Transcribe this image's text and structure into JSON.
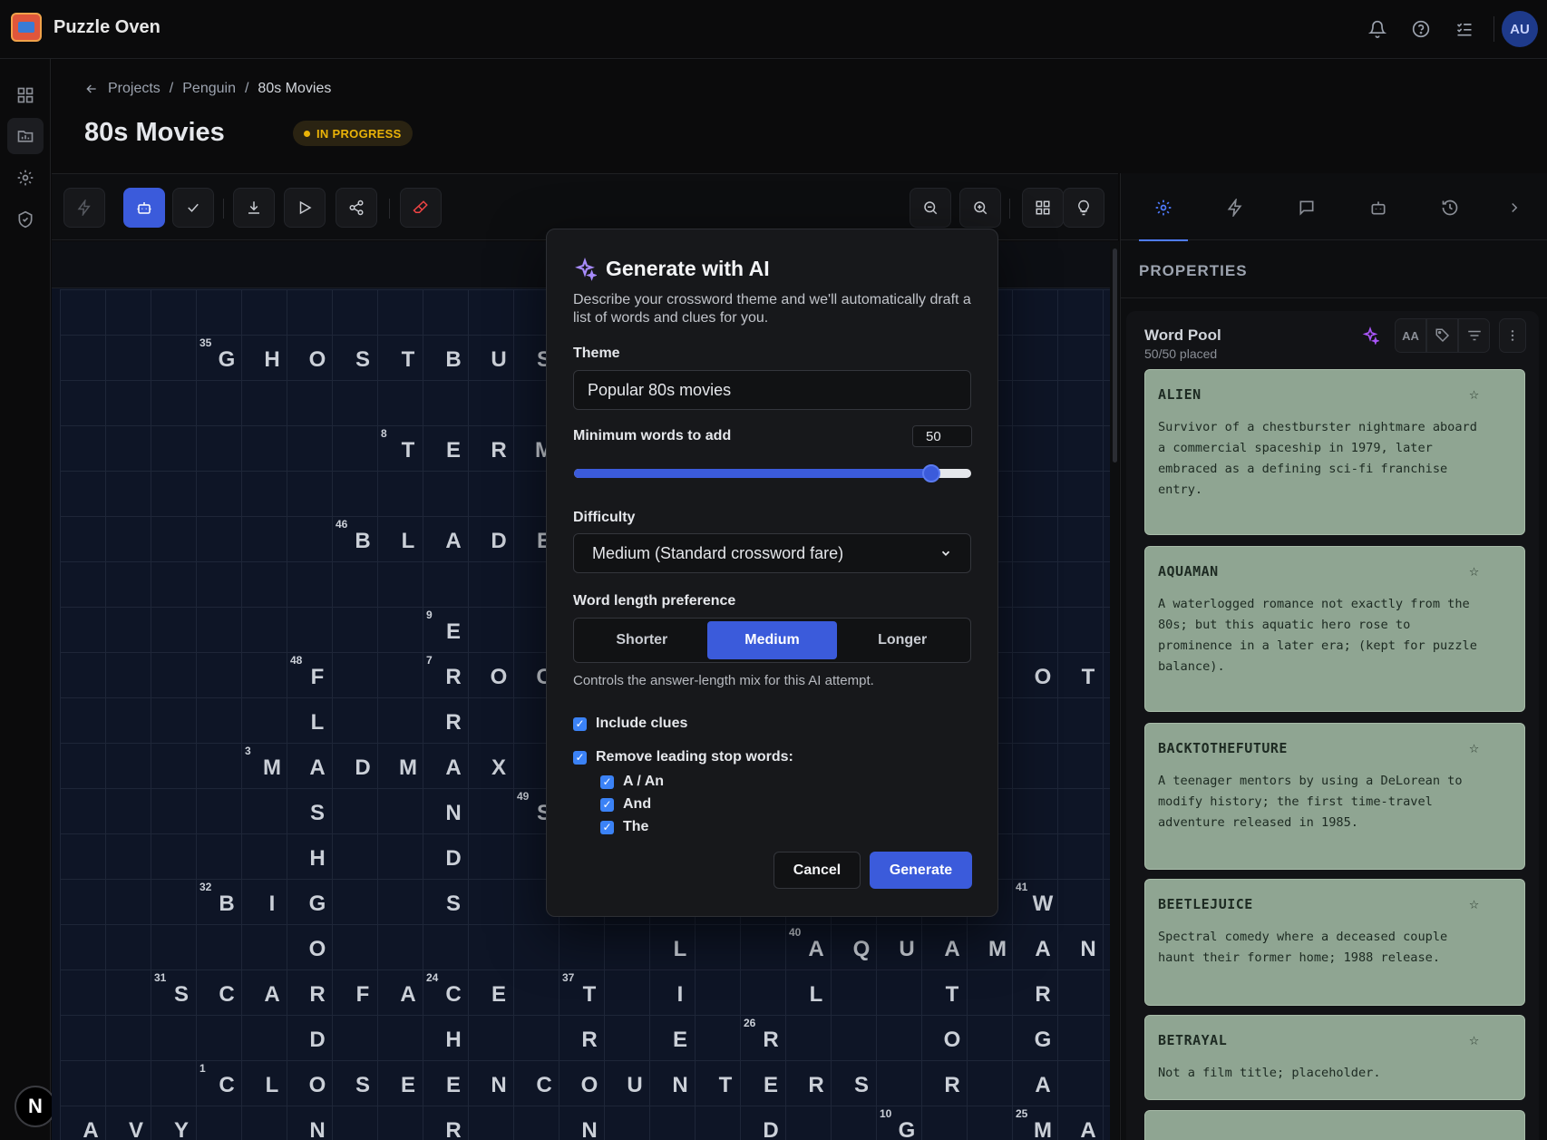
{
  "app": {
    "title": "Puzzle Oven",
    "avatar_initials": "AU",
    "corner_badge": "N"
  },
  "breadcrumb": {
    "back": "Projects",
    "sep1": "/",
    "mid": "Penguin",
    "sep2": "/",
    "current": "80s Movies"
  },
  "page": {
    "title": "80s Movies",
    "status": "IN PROGRESS"
  },
  "properties": {
    "title": "PROPERTIES"
  },
  "word_pool": {
    "title": "Word Pool",
    "placed": "50/50 placed",
    "case_toggle": "AA",
    "entries": [
      {
        "word": "ALIEN",
        "clue": "Survivor of a chestburster nightmare aboard a commercial spaceship in 1979, later embraced as a defining sci-fi franchise entry."
      },
      {
        "word": "AQUAMAN",
        "clue": "A waterlogged romance not exactly from the 80s; but this aquatic hero rose to prominence in a later era; (kept for puzzle balance)."
      },
      {
        "word": "BACKTOTHEFUTURE",
        "clue": "A teenager mentors by using a DeLorean to modify history; the first time-travel adventure released in 1985."
      },
      {
        "word": "BEETLEJUICE",
        "clue": "Spectral comedy where a deceased couple haunt their former home; 1988 release."
      },
      {
        "word": "BETRAYAL",
        "clue": "Not a film title; placeholder."
      }
    ]
  },
  "modal": {
    "title": "Generate with AI",
    "description": "Describe your crossword theme and we'll automatically draft a list of words and clues for you.",
    "theme_label": "Theme",
    "theme_value": "Popular 80s movies",
    "min_words_label": "Minimum words to add",
    "min_words_value": "50",
    "slider_fraction": 0.9,
    "difficulty_label": "Difficulty",
    "difficulty_value": "Medium (Standard crossword fare)",
    "word_length_label": "Word length preference",
    "word_length_options": [
      "Shorter",
      "Medium",
      "Longer"
    ],
    "word_length_selected": "Medium",
    "word_length_help": "Controls the answer-length mix for this AI attempt.",
    "include_clues": "Include clues",
    "remove_stop_words": "Remove leading stop words:",
    "stop_words": [
      "A / An",
      "And",
      "The"
    ],
    "cancel": "Cancel",
    "generate": "Generate"
  },
  "grid": {
    "letters": [
      {
        "r": 1,
        "c": 3,
        "ch": "G",
        "n": "35"
      },
      {
        "r": 1,
        "c": 4,
        "ch": "H"
      },
      {
        "r": 1,
        "c": 5,
        "ch": "O"
      },
      {
        "r": 1,
        "c": 6,
        "ch": "S"
      },
      {
        "r": 1,
        "c": 7,
        "ch": "T"
      },
      {
        "r": 1,
        "c": 8,
        "ch": "B"
      },
      {
        "r": 1,
        "c": 9,
        "ch": "U"
      },
      {
        "r": 1,
        "c": 10,
        "ch": "S"
      },
      {
        "r": 3,
        "c": 7,
        "ch": "T",
        "n": "8"
      },
      {
        "r": 3,
        "c": 8,
        "ch": "E"
      },
      {
        "r": 3,
        "c": 9,
        "ch": "R"
      },
      {
        "r": 3,
        "c": 10,
        "ch": "M"
      },
      {
        "r": 5,
        "c": 6,
        "ch": "B",
        "n": "46"
      },
      {
        "r": 5,
        "c": 7,
        "ch": "L"
      },
      {
        "r": 5,
        "c": 8,
        "ch": "A"
      },
      {
        "r": 5,
        "c": 9,
        "ch": "D"
      },
      {
        "r": 5,
        "c": 10,
        "ch": "E"
      },
      {
        "r": 7,
        "c": 8,
        "ch": "E",
        "n": "9"
      },
      {
        "r": 8,
        "c": 5,
        "ch": "F",
        "n": "48"
      },
      {
        "r": 8,
        "c": 8,
        "ch": "R",
        "n": "7"
      },
      {
        "r": 8,
        "c": 9,
        "ch": "O"
      },
      {
        "r": 8,
        "c": 10,
        "ch": "C"
      },
      {
        "r": 8,
        "c": 21,
        "ch": "O"
      },
      {
        "r": 8,
        "c": 22,
        "ch": "T"
      },
      {
        "r": 9,
        "c": 5,
        "ch": "L"
      },
      {
        "r": 9,
        "c": 8,
        "ch": "R"
      },
      {
        "r": 10,
        "c": 4,
        "ch": "M",
        "n": "3"
      },
      {
        "r": 10,
        "c": 5,
        "ch": "A"
      },
      {
        "r": 10,
        "c": 6,
        "ch": "D"
      },
      {
        "r": 10,
        "c": 7,
        "ch": "M"
      },
      {
        "r": 10,
        "c": 8,
        "ch": "A"
      },
      {
        "r": 10,
        "c": 9,
        "ch": "X"
      },
      {
        "r": 11,
        "c": 5,
        "ch": "S"
      },
      {
        "r": 11,
        "c": 8,
        "ch": "N"
      },
      {
        "r": 11,
        "c": 10,
        "ch": "S",
        "n": "49"
      },
      {
        "r": 12,
        "c": 5,
        "ch": "H"
      },
      {
        "r": 12,
        "c": 8,
        "ch": "D"
      },
      {
        "r": 13,
        "c": 3,
        "ch": "B",
        "n": "32"
      },
      {
        "r": 13,
        "c": 4,
        "ch": "I"
      },
      {
        "r": 13,
        "c": 5,
        "ch": "G"
      },
      {
        "r": 13,
        "c": 8,
        "ch": "S"
      },
      {
        "r": 13,
        "c": 21,
        "ch": "W",
        "n": "41"
      },
      {
        "r": 14,
        "c": 5,
        "ch": "O"
      },
      {
        "r": 14,
        "c": 13,
        "ch": "L"
      },
      {
        "r": 14,
        "c": 16,
        "ch": "A",
        "n": "40"
      },
      {
        "r": 14,
        "c": 17,
        "ch": "Q"
      },
      {
        "r": 14,
        "c": 18,
        "ch": "U"
      },
      {
        "r": 14,
        "c": 19,
        "ch": "A"
      },
      {
        "r": 14,
        "c": 20,
        "ch": "M"
      },
      {
        "r": 14,
        "c": 21,
        "ch": "A"
      },
      {
        "r": 14,
        "c": 22,
        "ch": "N"
      },
      {
        "r": 15,
        "c": 2,
        "ch": "S",
        "n": "31"
      },
      {
        "r": 15,
        "c": 3,
        "ch": "C"
      },
      {
        "r": 15,
        "c": 4,
        "ch": "A"
      },
      {
        "r": 15,
        "c": 5,
        "ch": "R"
      },
      {
        "r": 15,
        "c": 6,
        "ch": "F"
      },
      {
        "r": 15,
        "c": 7,
        "ch": "A"
      },
      {
        "r": 15,
        "c": 8,
        "ch": "C",
        "n": "24"
      },
      {
        "r": 15,
        "c": 9,
        "ch": "E"
      },
      {
        "r": 15,
        "c": 11,
        "ch": "T",
        "n": "37"
      },
      {
        "r": 15,
        "c": 13,
        "ch": "I"
      },
      {
        "r": 15,
        "c": 16,
        "ch": "L"
      },
      {
        "r": 15,
        "c": 19,
        "ch": "T"
      },
      {
        "r": 15,
        "c": 21,
        "ch": "R"
      },
      {
        "r": 16,
        "c": 5,
        "ch": "D"
      },
      {
        "r": 16,
        "c": 8,
        "ch": "H"
      },
      {
        "r": 16,
        "c": 11,
        "ch": "R"
      },
      {
        "r": 16,
        "c": 13,
        "ch": "E"
      },
      {
        "r": 16,
        "c": 15,
        "ch": "R",
        "n": "26"
      },
      {
        "r": 16,
        "c": 19,
        "ch": "O"
      },
      {
        "r": 16,
        "c": 21,
        "ch": "G"
      },
      {
        "r": 17,
        "c": 3,
        "ch": "C",
        "n": "1"
      },
      {
        "r": 17,
        "c": 4,
        "ch": "L"
      },
      {
        "r": 17,
        "c": 5,
        "ch": "O"
      },
      {
        "r": 17,
        "c": 6,
        "ch": "S"
      },
      {
        "r": 17,
        "c": 7,
        "ch": "E"
      },
      {
        "r": 17,
        "c": 8,
        "ch": "E"
      },
      {
        "r": 17,
        "c": 9,
        "ch": "N"
      },
      {
        "r": 17,
        "c": 10,
        "ch": "C"
      },
      {
        "r": 17,
        "c": 11,
        "ch": "O"
      },
      {
        "r": 17,
        "c": 12,
        "ch": "U"
      },
      {
        "r": 17,
        "c": 13,
        "ch": "N"
      },
      {
        "r": 17,
        "c": 14,
        "ch": "T"
      },
      {
        "r": 17,
        "c": 15,
        "ch": "E"
      },
      {
        "r": 17,
        "c": 16,
        "ch": "R"
      },
      {
        "r": 17,
        "c": 17,
        "ch": "S"
      },
      {
        "r": 17,
        "c": 19,
        "ch": "R"
      },
      {
        "r": 17,
        "c": 21,
        "ch": "A"
      },
      {
        "r": 18,
        "c": 0,
        "ch": "A"
      },
      {
        "r": 18,
        "c": 1,
        "ch": "V"
      },
      {
        "r": 18,
        "c": 2,
        "ch": "Y"
      },
      {
        "r": 18,
        "c": 5,
        "ch": "N"
      },
      {
        "r": 18,
        "c": 8,
        "ch": "R"
      },
      {
        "r": 18,
        "c": 11,
        "ch": "N"
      },
      {
        "r": 18,
        "c": 15,
        "ch": "D"
      },
      {
        "r": 18,
        "c": 18,
        "ch": "G",
        "n": "10"
      },
      {
        "r": 18,
        "c": 21,
        "ch": "M",
        "n": "25"
      },
      {
        "r": 18,
        "c": 22,
        "ch": "A"
      }
    ]
  }
}
